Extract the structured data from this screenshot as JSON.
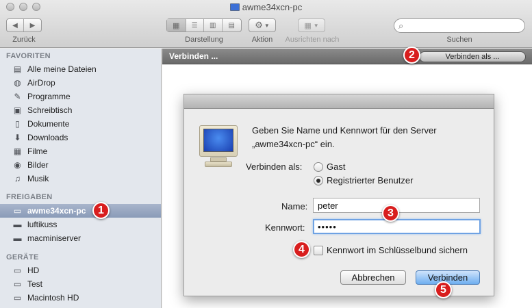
{
  "window": {
    "title": "awme34xcn-pc"
  },
  "toolbar": {
    "back_label": "Zurück",
    "view_label": "Darstellung",
    "action_label": "Aktion",
    "arrange_label": "Ausrichten nach",
    "search_label": "Suchen",
    "search_value": ""
  },
  "sidebar": {
    "favorites_header": "FAVORITEN",
    "favorites": [
      {
        "label": "Alle meine Dateien",
        "icon": "all-files-icon"
      },
      {
        "label": "AirDrop",
        "icon": "airdrop-icon"
      },
      {
        "label": "Programme",
        "icon": "applications-icon"
      },
      {
        "label": "Schreibtisch",
        "icon": "desktop-icon"
      },
      {
        "label": "Dokumente",
        "icon": "documents-icon"
      },
      {
        "label": "Downloads",
        "icon": "downloads-icon"
      },
      {
        "label": "Filme",
        "icon": "movies-icon"
      },
      {
        "label": "Bilder",
        "icon": "pictures-icon"
      },
      {
        "label": "Musik",
        "icon": "music-icon"
      }
    ],
    "shared_header": "FREIGABEN",
    "shared": [
      {
        "label": "awme34xcn-pc",
        "icon": "pc-icon",
        "selected": true
      },
      {
        "label": "luftikuss",
        "icon": "server-icon"
      },
      {
        "label": "macminiserver",
        "icon": "server-icon"
      }
    ],
    "devices_header": "GERÄTE",
    "devices": [
      {
        "label": "HD",
        "icon": "drive-icon"
      },
      {
        "label": "Test",
        "icon": "drive-icon"
      },
      {
        "label": "Macintosh HD",
        "icon": "drive-icon"
      }
    ]
  },
  "main": {
    "status_title": "Verbinden ...",
    "connect_as_button": "Verbinden als ..."
  },
  "dialog": {
    "message_line1": "Geben Sie Name und Kennwort für den Server",
    "message_line2": "„awme34xcn-pc“ ein.",
    "connect_as_label": "Verbinden als:",
    "option_guest": "Gast",
    "option_registered": "Registrierter Benutzer",
    "selected_option": "registered",
    "name_label": "Name:",
    "name_value": "peter",
    "password_label": "Kennwort:",
    "password_value": "•••••",
    "keychain_label": "Kennwort im Schlüsselbund sichern",
    "keychain_checked": false,
    "cancel_button": "Abbrechen",
    "connect_button": "Verbinden"
  },
  "badges": [
    "1",
    "2",
    "3",
    "4",
    "5"
  ],
  "colors": {
    "badge": "#d81e1e",
    "selection": "#8a9bb8",
    "default_button": "#6eaef0"
  }
}
